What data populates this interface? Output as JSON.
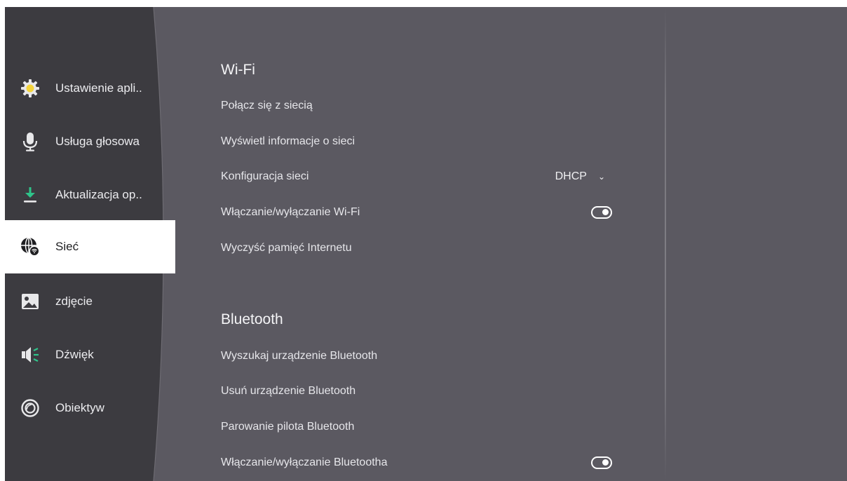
{
  "sidebar": {
    "items": [
      {
        "label": "Ustawienie apli..",
        "icon": "gear-icon"
      },
      {
        "label": "Usługa głosowa",
        "icon": "microphone-icon"
      },
      {
        "label": "Aktualizacja op..",
        "icon": "download-icon"
      },
      {
        "label": "Sieć",
        "icon": "globe-wifi-icon",
        "selected": true
      },
      {
        "label": "zdjęcie",
        "icon": "image-icon"
      },
      {
        "label": "Dźwięk",
        "icon": "speaker-icon"
      },
      {
        "label": "Obiektyw",
        "icon": "lens-icon"
      }
    ]
  },
  "main": {
    "wifi": {
      "title": "Wi-Fi",
      "rows": [
        {
          "label": "Połącz się z siecią"
        },
        {
          "label": "Wyświetl informacje o sieci"
        },
        {
          "label": "Konfiguracja sieci",
          "value": "DHCP"
        },
        {
          "label": "Włączanie/wyłączanie Wi-Fi",
          "toggle": "on"
        },
        {
          "label": "Wyczyść pamięć Internetu"
        }
      ]
    },
    "bluetooth": {
      "title": "Bluetooth",
      "rows": [
        {
          "label": "Wyszukaj urządzenie Bluetooth"
        },
        {
          "label": "Usuń urządzenie Bluetooth"
        },
        {
          "label": "Parowanie pilota Bluetooth"
        },
        {
          "label": "Włączanie/wyłączanie Bluetootha",
          "toggle": "on"
        }
      ]
    }
  },
  "colors": {
    "background": "#5b5961",
    "sidebar": "#3c3b40",
    "selected": "#ffffff",
    "gear_accent": "#f4d43c",
    "download_accent": "#2ec48a"
  }
}
